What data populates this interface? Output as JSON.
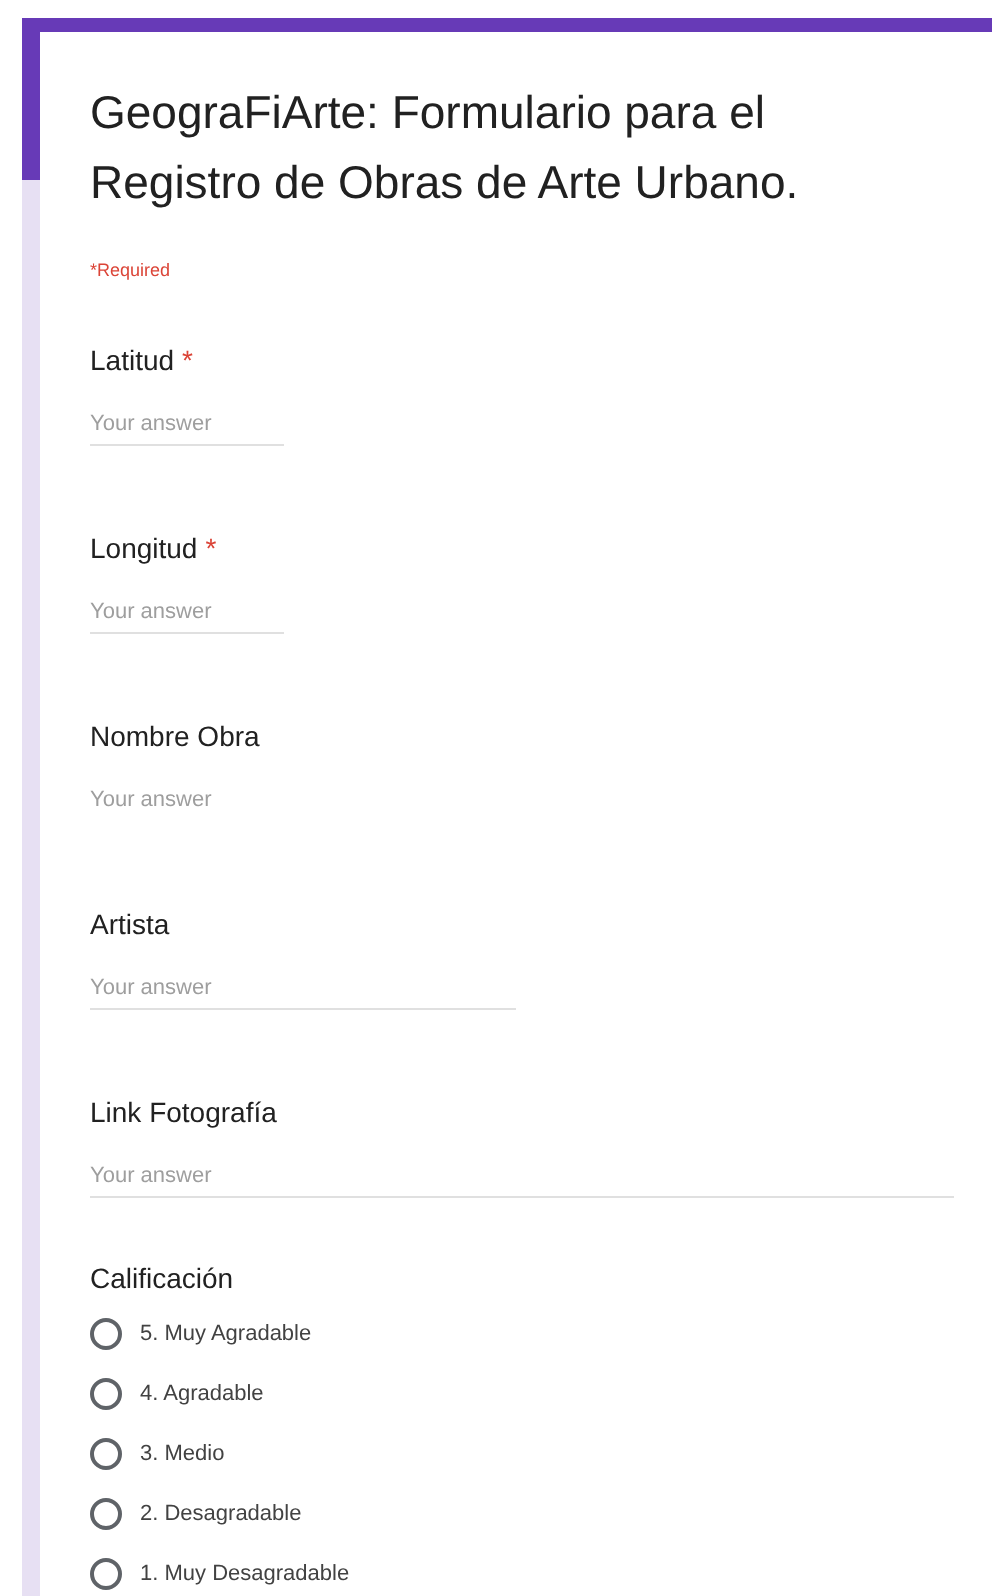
{
  "form": {
    "title": "GeograFiArte: Formulario para el Registro de Obras de Arte Urbano.",
    "required_note": "*Required"
  },
  "questions": [
    {
      "label": "Latitud",
      "required_mark": "*",
      "kind": "short",
      "placeholder": "Your answer"
    },
    {
      "label": "Longitud",
      "required_mark": "*",
      "kind": "short",
      "placeholder": "Your answer"
    },
    {
      "label": "Nombre Obra",
      "kind": "plain",
      "placeholder": "Your answer"
    },
    {
      "label": "Artista",
      "kind": "medium",
      "placeholder": "Your answer"
    },
    {
      "label": "Link Fotografía",
      "kind": "long",
      "placeholder": "Your answer"
    }
  ],
  "rating": {
    "label": "Calificación",
    "options": [
      {
        "label": "5. Muy Agradable",
        "selected": false
      },
      {
        "label": "4. Agradable",
        "selected": false
      },
      {
        "label": "3. Medio",
        "selected": false
      },
      {
        "label": "2. Desagradable",
        "selected": false
      },
      {
        "label": "1. Muy Desagradable",
        "selected": false
      }
    ]
  }
}
